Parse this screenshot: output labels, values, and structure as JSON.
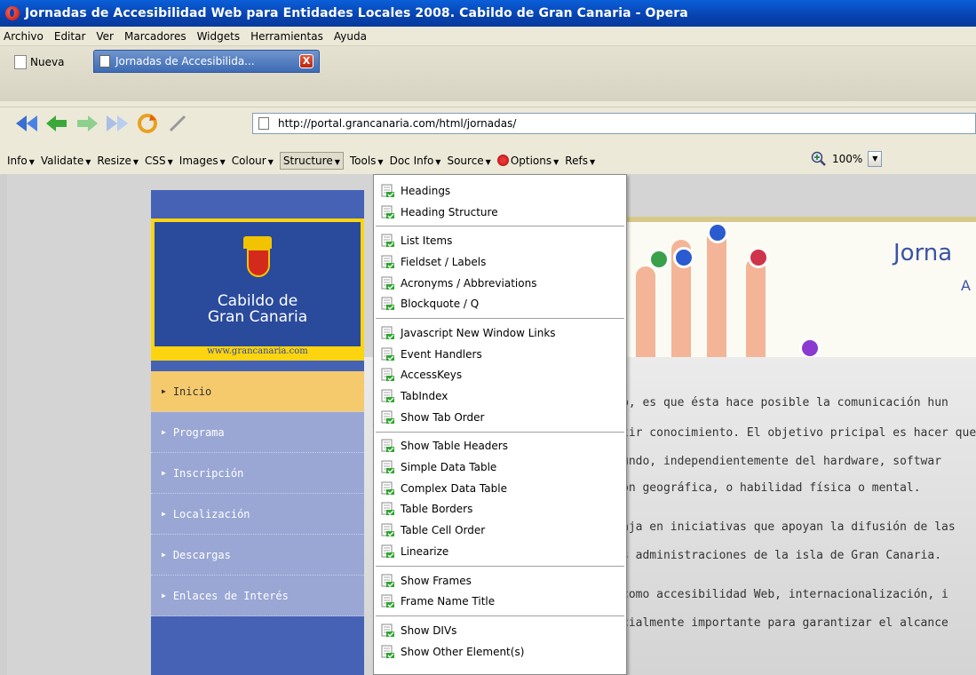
{
  "window": {
    "title": "Jornadas de Accesibilidad Web para Entidades Locales 2008. Cabildo de Gran Canaria - Opera"
  },
  "menu": [
    "Archivo",
    "Editar",
    "Ver",
    "Marcadores",
    "Widgets",
    "Herramientas",
    "Ayuda"
  ],
  "tabs": {
    "new_label": "Nueva",
    "active_label": "Jornadas de Accesibilida...",
    "close_glyph": "X"
  },
  "address": {
    "url": "http://portal.grancanaria.com/html/jornadas/"
  },
  "devbar": {
    "items": [
      "Info",
      "Validate",
      "Resize",
      "CSS",
      "Images",
      "Colour",
      "Structure",
      "Tools",
      "Doc Info",
      "Source",
      "Options",
      "Refs"
    ],
    "active": "Structure",
    "caret": "▼",
    "zoom": "100%"
  },
  "structure_menu": [
    [
      "Headings",
      "Heading Structure"
    ],
    [
      "List Items",
      "Fieldset / Labels",
      "Acronyms / Abbreviations",
      "Blockquote / Q"
    ],
    [
      "Javascript  New Window Links",
      "Event Handlers",
      "AccessKeys",
      "TabIndex",
      "Show Tab Order"
    ],
    [
      "Show Table Headers",
      "Simple Data Table",
      "Complex Data Table",
      "Table Borders",
      "Table Cell Order",
      "Linearize"
    ],
    [
      "Show Frames",
      "Frame Name Title"
    ],
    [
      "Show DIVs",
      "Show Other Element(s)"
    ]
  ],
  "site": {
    "logo_line1": "Cabildo de",
    "logo_line2": "Gran Canaria",
    "logo_url": "www.grancanaria.com",
    "nav": [
      "Inicio",
      "Programa",
      "Inscripción",
      "Localización",
      "Descargas",
      "Enlaces de Interés"
    ],
    "banner_title": "Jorna",
    "banner_sub": "A",
    "paragraphs": [
      "b, es que ésta hace posible la comunicación hun",
      "tir conocimiento. El objetivo pricipal es hacer que",
      "undo, independientemente del hardware, softwar",
      "ón geográfica, o habilidad física o mental.",
      "aja en iniciativas que apoyan la difusión de las",
      "s administraciones de la isla de Gran Canaria.",
      "como accesibilidad Web, internacionalización, i",
      "cialmente importante para garantizar el alcance"
    ]
  },
  "colors": {
    "title_bar": "#0842b0",
    "site_blue": "#4562b4",
    "nav_active": "#f5ca6d",
    "logo_yellow": "#fcd410"
  }
}
